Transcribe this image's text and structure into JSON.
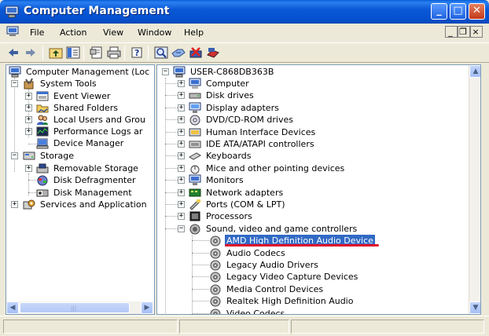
{
  "window": {
    "title": "Computer Management",
    "accent": "#0a58d6"
  },
  "menu": {
    "items": [
      "File",
      "Action",
      "View",
      "Window",
      "Help"
    ]
  },
  "left_tree": {
    "root": "Computer Management (Loc",
    "system_tools": "System Tools",
    "event_viewer": "Event Viewer",
    "shared_folders": "Shared Folders",
    "local_users": "Local Users and Grou",
    "performance_logs": "Performance Logs ar",
    "device_manager": "Device Manager",
    "storage": "Storage",
    "removable_storage": "Removable Storage",
    "disk_defragmenter": "Disk Defragmenter",
    "disk_management": "Disk Management",
    "services": "Services and Application"
  },
  "right_tree": {
    "root": "USER-C868DB363B",
    "categories": [
      "Computer",
      "Disk drives",
      "Display adapters",
      "DVD/CD-ROM drives",
      "Human Interface Devices",
      "IDE ATA/ATAPI controllers",
      "Keyboards",
      "Mice and other pointing devices",
      "Monitors",
      "Network adapters",
      "Ports (COM & LPT)",
      "Processors",
      "Sound, video and game controllers"
    ],
    "sound_children": [
      "AMD High Definition Audio Device",
      "Audio Codecs",
      "Legacy Audio Drivers",
      "Legacy Video Capture Devices",
      "Media Control Devices",
      "Realtek High Definition Audio",
      "Video Codecs"
    ],
    "selected": "AMD High Definition Audio Device",
    "highlight_color": "#e0102a"
  }
}
